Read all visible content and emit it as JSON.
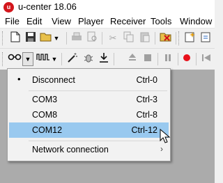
{
  "app": {
    "title": "u-center 18.06",
    "logo_letter": "u"
  },
  "menubar": {
    "items": [
      "File",
      "Edit",
      "View",
      "Player",
      "Receiver",
      "Tools",
      "Window"
    ]
  },
  "toolbar1": {
    "icons": [
      "new-file-icon",
      "save-icon",
      "open-folder-icon",
      "chevron-down-icon",
      "print-icon",
      "print-preview-icon",
      "cut-icon",
      "copy-icon",
      "paste-icon",
      "close-file-icon",
      "new-view-icon",
      "export-icon"
    ]
  },
  "toolbar2": {
    "icons": [
      "connection-icon",
      "chevron-down-icon",
      "baudrate-icon",
      "chevron-down-icon",
      "autobaud-wand-icon",
      "debug-icon",
      "download-icon",
      "eject-icon",
      "stop-icon",
      "pause-icon",
      "record-icon",
      "rewind-icon"
    ]
  },
  "connection_menu": {
    "items": [
      {
        "label": "Disconnect",
        "shortcut": "Ctrl-0",
        "checked": true
      },
      {
        "label": "COM3",
        "shortcut": "Ctrl-3"
      },
      {
        "label": "COM8",
        "shortcut": "Ctrl-8"
      },
      {
        "label": "COM12",
        "shortcut": "Ctrl-12",
        "highlighted": true
      },
      {
        "label": "Network connection",
        "submenu": true
      }
    ],
    "bullet": "•",
    "submenu_arrow": "›"
  },
  "colors": {
    "highlight": "#99c9ef",
    "workspace": "#ababab",
    "record": "#e8101a",
    "logo": "#d3161c"
  }
}
